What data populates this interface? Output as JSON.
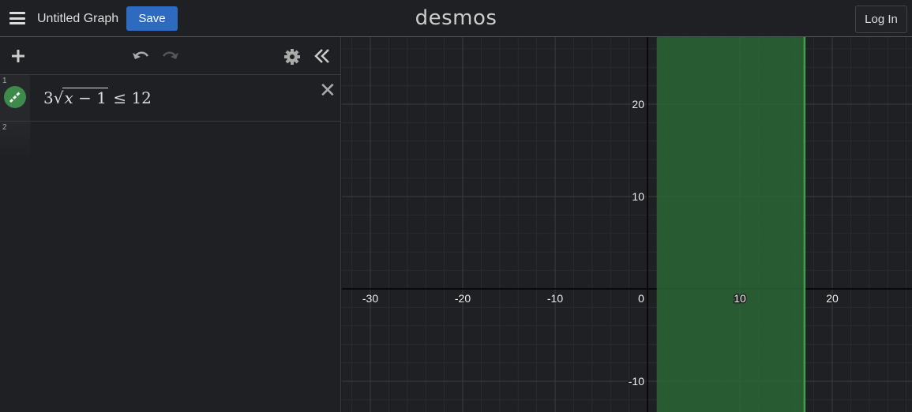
{
  "header": {
    "title": "Untitled Graph",
    "save_label": "Save",
    "logo": "desmos",
    "login_label": "Log In"
  },
  "toolbar": {
    "add_icon": "plus-icon",
    "undo_icon": "undo-icon",
    "redo_icon": "redo-icon",
    "settings_icon": "gear-icon",
    "collapse_icon": "double-chevron-left-icon"
  },
  "expressions": [
    {
      "number": "1",
      "coef": "3",
      "radicand_var": "x",
      "radicand_rest": " − 1",
      "relation": "≤",
      "rhs": "12",
      "color": "#3d8a4a"
    },
    {
      "number": "2"
    }
  ],
  "graph": {
    "x_ticks": [
      "-30",
      "-20",
      "-10",
      "0",
      "10",
      "20"
    ],
    "y_ticks": [
      "20",
      "10",
      "-10"
    ],
    "shade_from_x": 1,
    "shade_to_x": 17,
    "shade_color": "#2a6a36",
    "boundary_color": "#3fa04f"
  }
}
